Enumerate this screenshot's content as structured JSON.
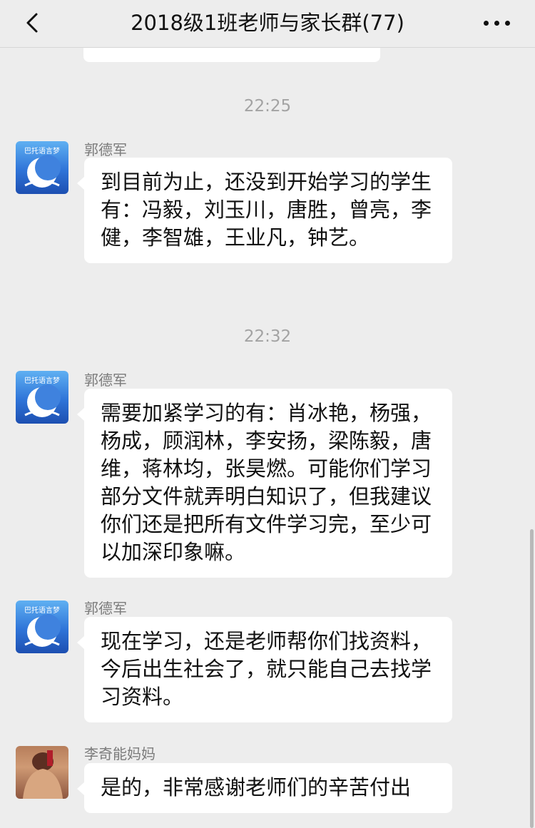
{
  "header": {
    "title": "2018级1班老师与家长群(77)",
    "back_icon": "chevron-left-icon",
    "more_icon": "more-horizontal-icon"
  },
  "timestamps": [
    "22:25",
    "22:32"
  ],
  "messages": [
    {
      "sender": "郭德军",
      "text": "到目前为止，还没到开始学习的学生有：冯毅，刘玉川，唐胜，曾亮，李健，李智雄，王业凡，钟艺。",
      "avatar": "blue-moon-avatar",
      "avatar_caption": "巴托语言梦"
    },
    {
      "sender": "郭德军",
      "text": "需要加紧学习的有：肖冰艳，杨强，杨成，顾润林，李安扬，梁陈毅，唐维，蒋林均，张昊燃。可能你们学习部分文件就弄明白知识了，但我建议你们还是把所有文件学习完，至少可以加深印象嘛。",
      "avatar": "blue-moon-avatar",
      "avatar_caption": "巴托语言梦"
    },
    {
      "sender": "郭德军",
      "text": "现在学习，还是老师帮你们找资料，今后出生社会了，就只能自己去找学习资料。",
      "avatar": "blue-moon-avatar",
      "avatar_caption": "巴托语言梦"
    },
    {
      "sender": "李奇能妈妈",
      "text": "是的，非常感谢老师们的辛苦付出",
      "avatar": "photo-avatar"
    }
  ],
  "colors": {
    "background": "#ededed",
    "bubble": "#ffffff",
    "timestamp": "#a3a3a3",
    "sender": "#7b7b7b",
    "text": "#111111"
  }
}
